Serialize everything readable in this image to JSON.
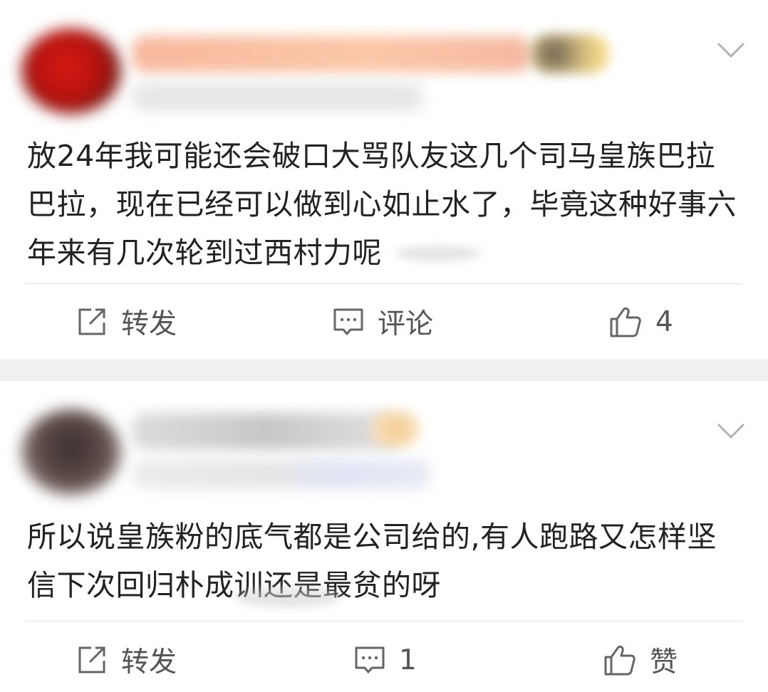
{
  "posts": [
    {
      "content": "放24年我可能还会破口大骂队友这几个司马皇族巴拉巴拉，现在已经可以做到心如止水了，毕竟这种好事六年来有几次轮到过西村力呢",
      "actions": {
        "repost": "转发",
        "comment": "评论",
        "like": "4"
      }
    },
    {
      "content": "所以说皇族粉的底气都是公司给的,有人跑路又怎样坚信下次回归朴成训还是最贫的呀",
      "actions": {
        "repost": "转发",
        "comment": "1",
        "like": "赞"
      }
    }
  ],
  "icons": {
    "expand": "chevron-down-icon",
    "repost": "share-icon",
    "comment": "comment-icon",
    "like": "thumbs-up-icon"
  },
  "colors": {
    "text": "#222222",
    "action_text": "#555555",
    "divider": "#e2e2e2",
    "gap": "#f0f0f0"
  }
}
